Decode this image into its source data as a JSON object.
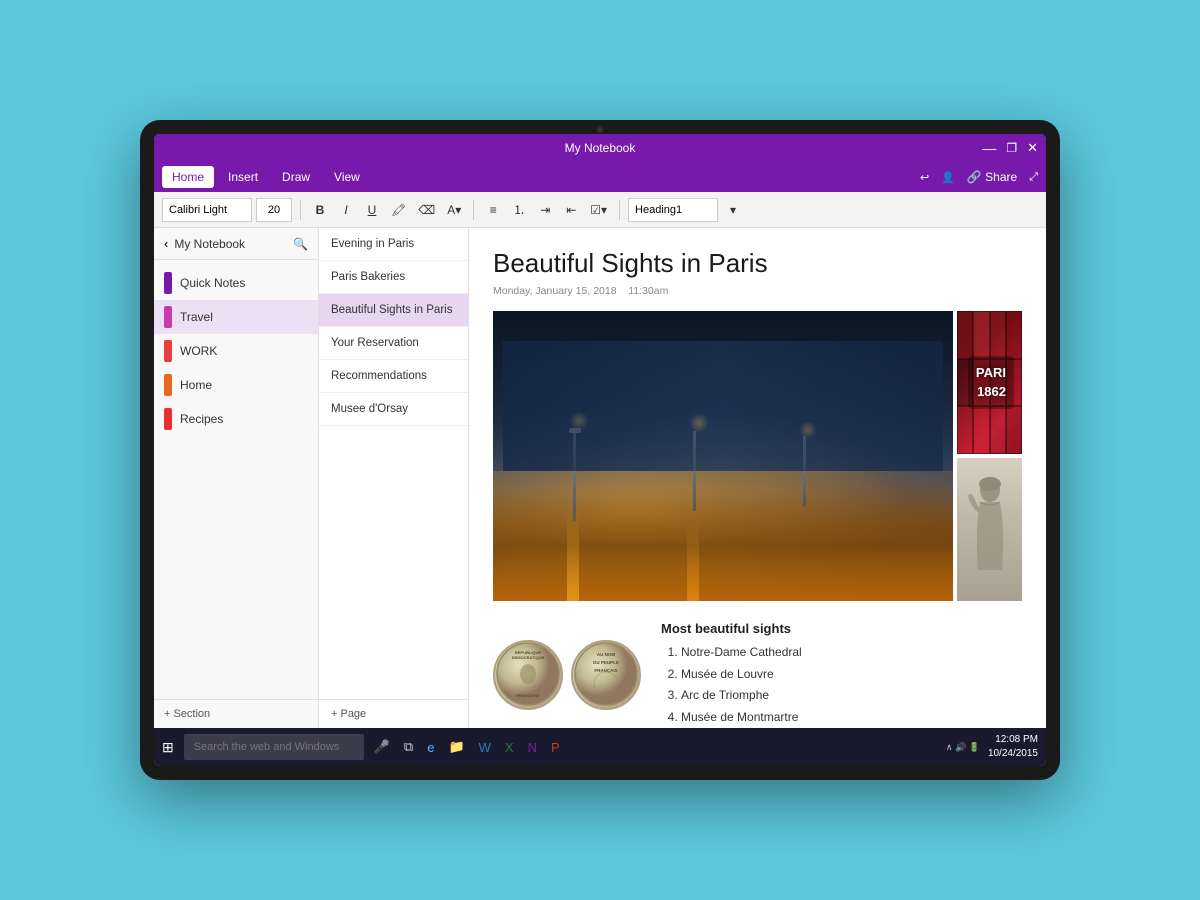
{
  "app": {
    "title": "My Notebook",
    "window_controls": [
      "—",
      "❐",
      "✕"
    ]
  },
  "menu": {
    "items": [
      "Home",
      "Insert",
      "Draw",
      "View"
    ],
    "active": "Home",
    "right_actions": [
      "↩",
      "👤",
      "Share",
      "⤢"
    ]
  },
  "toolbar": {
    "font": "Calibri Light",
    "size": "20",
    "bold": "B",
    "italic": "I",
    "underline": "U",
    "style": "Heading1"
  },
  "sidebar": {
    "title": "My Notebook",
    "sections": [
      {
        "label": "Quick Notes",
        "color": "#7719aa"
      },
      {
        "label": "Travel",
        "color": "#c43daa",
        "active": true
      },
      {
        "label": "WORK",
        "color": "#e84040"
      },
      {
        "label": "Home",
        "color": "#e86820"
      },
      {
        "label": "Recipes",
        "color": "#e83030"
      }
    ],
    "add_section": "+ Section"
  },
  "notes_panel": {
    "items": [
      {
        "label": "Evening in Paris",
        "active": false
      },
      {
        "label": "Paris Bakeries",
        "active": false
      },
      {
        "label": "Beautiful Sights in Paris",
        "active": true
      },
      {
        "label": "Your Reservation",
        "active": false
      },
      {
        "label": "Recommendations",
        "active": false
      },
      {
        "label": "Musee d'Orsay",
        "active": false
      }
    ],
    "add_page": "+ Page"
  },
  "note": {
    "title": "Beautiful Sights in Paris",
    "date": "Monday, January 15, 2018",
    "time": "11:30am",
    "sights": {
      "heading": "Most beautiful sights",
      "list": [
        "Notre-Dame Cathedral",
        "Musée de Louvre",
        "Arc de Triomphe",
        "Musée de Montmartre"
      ]
    },
    "coin1_text": "REPUBLIQUE\nDEMOCRATIQUE",
    "coin2_text": "AU NOM\nDU PEUPLE\nFRANÇAIS",
    "paris_sign": "PARI\n1862"
  },
  "taskbar": {
    "search_placeholder": "Search the web and Windows",
    "time": "12:08 PM",
    "date": "10/24/2015"
  }
}
